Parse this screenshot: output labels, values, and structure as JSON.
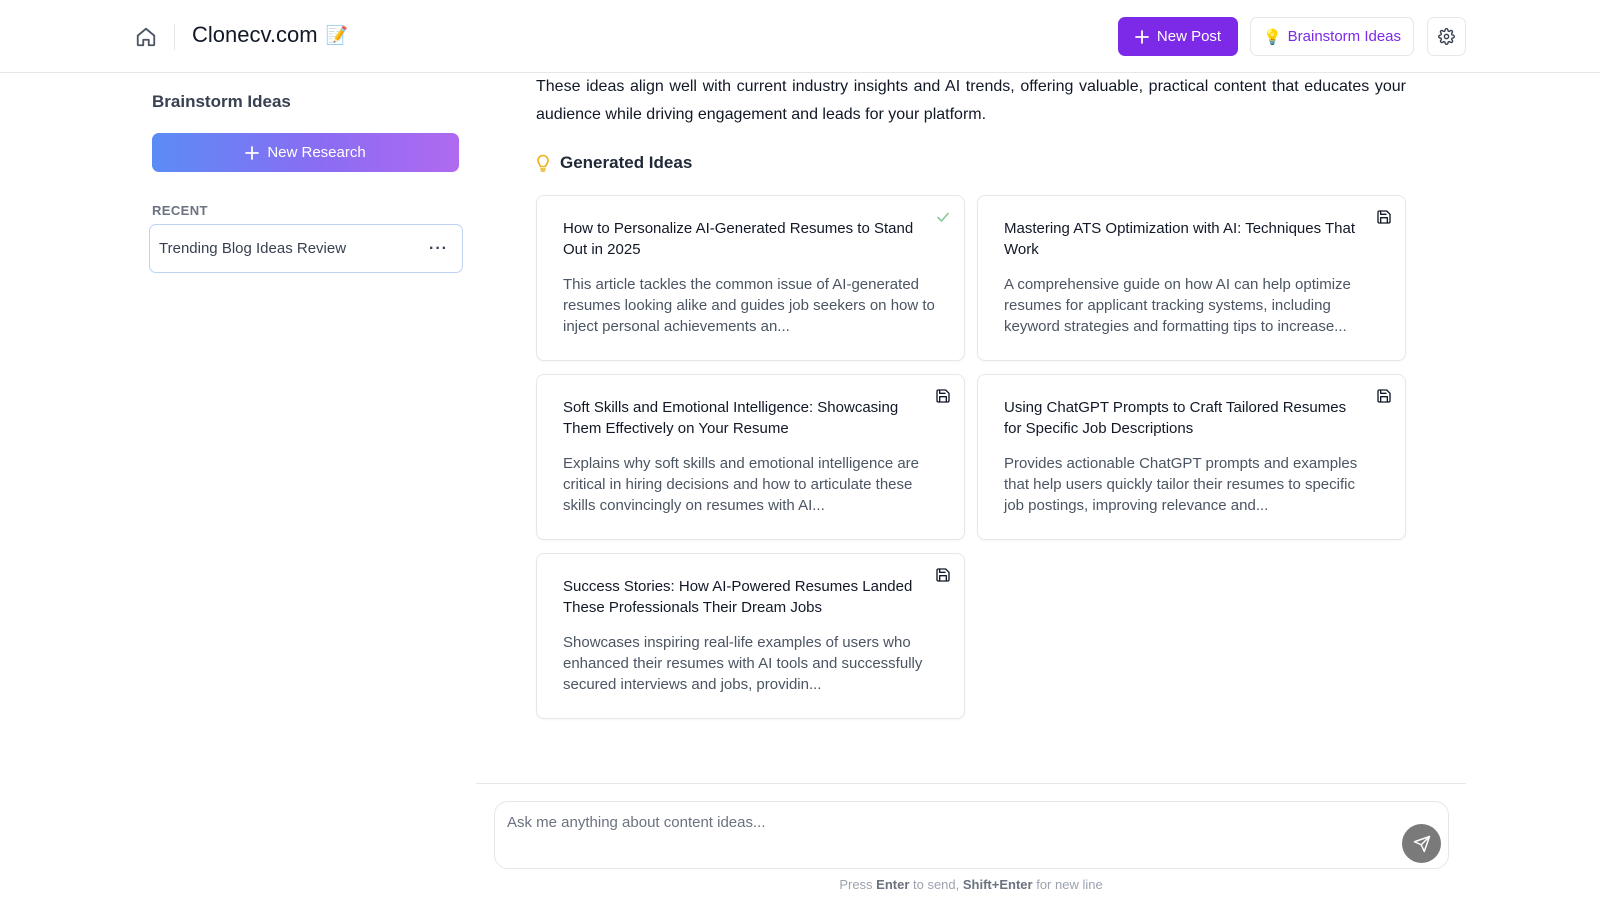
{
  "header": {
    "app_title": "Clonecv.com",
    "app_title_emoji": "📝",
    "new_post_label": "New Post",
    "brainstorm_label": "Brainstorm Ideas",
    "brainstorm_emoji": "💡"
  },
  "sidebar": {
    "title": "Brainstorm Ideas",
    "new_research_label": "New Research",
    "recent_label": "RECENT",
    "recent_items": [
      {
        "label": "Trending Blog Ideas Review",
        "more": "···"
      }
    ]
  },
  "main": {
    "intro_text": "These ideas align well with current industry insights and AI trends, offering valuable, practical content that educates your audience while driving engagement and leads for your platform.",
    "generated_heading": "Generated Ideas",
    "ideas": [
      {
        "title": "How to Personalize AI-Generated Resumes to Stand Out in 2025",
        "description": "This article tackles the common issue of AI-generated resumes looking alike and guides job seekers on how to inject personal achievements an...",
        "status_icon": "check-icon"
      },
      {
        "title": "Mastering ATS Optimization with AI: Techniques That Work",
        "description": "A comprehensive guide on how AI can help optimize resumes for applicant tracking systems, including keyword strategies and formatting tips to increase...",
        "status_icon": "save-icon"
      },
      {
        "title": "Soft Skills and Emotional Intelligence: Showcasing Them Effectively on Your Resume",
        "description": "Explains why soft skills and emotional intelligence are critical in hiring decisions and how to articulate these skills convincingly on resumes with AI...",
        "status_icon": "save-icon"
      },
      {
        "title": "Using ChatGPT Prompts to Craft Tailored Resumes for Specific Job Descriptions",
        "description": "Provides actionable ChatGPT prompts and examples that help users quickly tailor their resumes to specific job postings, improving relevance and...",
        "status_icon": "save-icon"
      },
      {
        "title": "Success Stories: How AI-Powered Resumes Landed These Professionals Their Dream Jobs",
        "description": "Showcases inspiring real-life examples of users who enhanced their resumes with AI tools and successfully secured interviews and jobs, providin...",
        "status_icon": "save-icon"
      }
    ]
  },
  "composer": {
    "placeholder": "Ask me anything about content ideas...",
    "value": "",
    "hint_prefix": "Press ",
    "hint_key_send": "Enter",
    "hint_mid": " to send, ",
    "hint_key_newline": "Shift+Enter",
    "hint_suffix": " for new line"
  },
  "colors": {
    "accent": "#7c2ae8",
    "check": "#86c99a",
    "bulb": "#e8b21a"
  }
}
